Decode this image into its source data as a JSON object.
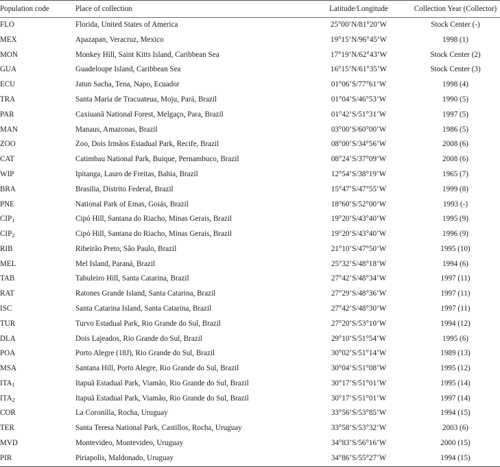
{
  "table": {
    "columns": [
      {
        "key": "code",
        "label": "Population code"
      },
      {
        "key": "place",
        "label": "Place of collection"
      },
      {
        "key": "coord",
        "label": "Latitude/Longitude"
      },
      {
        "key": "year",
        "label": "Collection Year (Collector)"
      }
    ],
    "rows": [
      {
        "code": "FLO",
        "code_sub": "",
        "place": "Florida,  United States of America",
        "coord": "25°00’N/81°20’W",
        "year": "Stock Center (-)"
      },
      {
        "code": "MEX",
        "code_sub": "",
        "place": "Apazapan,  Veracruz,  Mexico",
        "coord": "19°15’N/96°45’W",
        "year": "1998 (1)"
      },
      {
        "code": "MON",
        "code_sub": "",
        "place": "Monkey Hill,  Saint Kitts Island,  Caribbean Sea",
        "coord": "17°19’N/62°43’W",
        "year": "Stock Center (2)"
      },
      {
        "code": "GUA",
        "code_sub": "",
        "place": "Guadeloupe Island,  Caribbean Sea",
        "coord": "16°15’N/61°35’W",
        "year": "Stock Center (3)"
      },
      {
        "code": "ECU",
        "code_sub": "",
        "place": "Jatun Sacha,  Tena,  Napo,  Ecuador",
        "coord": "01°06’S/77°61’W",
        "year": "1998 (4)"
      },
      {
        "code": "TRA",
        "code_sub": "",
        "place": "Santa Maria de Tracuateua,  Moju,  Pará,  Brazil",
        "coord": "01°04’S/46°53’W",
        "year": "1990 (5)"
      },
      {
        "code": "PAR",
        "code_sub": "",
        "place": "Caxiuanã National Forest,  Melgaço,  Para,  Brazil",
        "coord": "01°42’S/51°31’W",
        "year": "1997 (5)"
      },
      {
        "code": "MAN",
        "code_sub": "",
        "place": "Manaus,  Amazonas,  Brazil",
        "coord": "03°00’S/60°00’W",
        "year": "1986 (5)"
      },
      {
        "code": "ZOO",
        "code_sub": "",
        "place": "Zoo,  Dois Irmãos Estadual Park,  Recife,  Brazil",
        "coord": "08°00’S/34°56’W",
        "year": "2008 (6)"
      },
      {
        "code": "CAT",
        "code_sub": "",
        "place": "Catimbau National Park,  Buique,  Pernambuco,  Brazil",
        "coord": "08°24’S/37°09’W",
        "year": "2008  (6)"
      },
      {
        "code": "WIP",
        "code_sub": "",
        "place": "Ipitanga,  Lauro de Freitas,  Bahia,  Brazil",
        "coord": "12°54’S/38°19’W",
        "year": "1965 (7)"
      },
      {
        "code": "BRA",
        "code_sub": "",
        "place": "Brasilia,  Distrito Federal,  Brazil",
        "coord": "15°47’S/47°55’W",
        "year": "1999 (8)"
      },
      {
        "code": "PNE",
        "code_sub": "",
        "place": "National Park of Emas,  Goiás,  Brazil",
        "coord": "18°60’S/52°00’W",
        "year": "1993 (-)"
      },
      {
        "code": "CIP",
        "code_sub": "1",
        "place": "Cipó Hill,  Santana do Riacho,  Minas Gerais,  Brazil",
        "coord": "19°20’S/43°40’W",
        "year": "1995 (9)"
      },
      {
        "code": "CIP",
        "code_sub": "2",
        "place": "Cipó Hill,  Santana do Riacho,  Minas Gerais,  Brazil",
        "coord": "19°20’S/43°40’W",
        "year": "1996 (9)"
      },
      {
        "code": "RIB",
        "code_sub": "",
        "place": "Ribeirão Preto,  São Paulo,  Brazil",
        "coord": "21°10’S/47°50’W",
        "year": "1995 (10)"
      },
      {
        "code": "MEL",
        "code_sub": "",
        "place": "Mel Island,  Paraná,  Brazil",
        "coord": "25°32’S/48°18’W",
        "year": "1994 (6)"
      },
      {
        "code": "TAB",
        "code_sub": "",
        "place": "Tabuleiro Hill,  Santa Catarina,  Brazil",
        "coord": "27°42’S/48°34’W",
        "year": "1997 (11)"
      },
      {
        "code": "RAT",
        "code_sub": "",
        "place": "Ratones Grande Island,  Santa Catarina,  Brazil",
        "coord": "27°29’S/48°36’W",
        "year": "1997 (11)"
      },
      {
        "code": "ISC",
        "code_sub": "",
        "place": "Santa Catarina Island,  Santa Catarina,  Brazil",
        "coord": "27°42’S/48°30’W",
        "year": "1997 (11)"
      },
      {
        "code": "TUR",
        "code_sub": "",
        "place": "Turvo Estadual Park,  Rio Grande do Sul,  Brazil",
        "coord": "27°20’S/53°10’W",
        "year": "1994 (12)"
      },
      {
        "code": "DLA",
        "code_sub": "",
        "place": "Dois Lajeados,  Rio Grande do Sul,  Brazil",
        "coord": "29°10’S/51°54’W",
        "year": "1995 (6)"
      },
      {
        "code": "POA",
        "code_sub": "",
        "place": "Porto Alegre (18J),  Rio Grande do Sul,  Brazil",
        "coord": "30°02’S/51°14’W",
        "year": "1989 (13)"
      },
      {
        "code": "MSA",
        "code_sub": "",
        "place": "Santana Hill,  Porto Alegre,  Rio Grande do Sul,  Brazil",
        "coord": "30°04’S/51°08’W",
        "year": "1995 (12)"
      },
      {
        "code": "ITA",
        "code_sub": "1",
        "place": "Itapuã Estadual Park,  Viamão,  Rio Grande do Sul,  Brazil",
        "coord": "30°17’S/51°01’W",
        "year": "1995 (14)"
      },
      {
        "code": "ITA",
        "code_sub": "2",
        "place": "Itapuã Estadual Park,  Viamão,  Rio Grande do Sul,  Brazil",
        "coord": "30°17’S/51°01’W",
        "year": "1997 (14)"
      },
      {
        "code": "COR",
        "code_sub": "",
        "place": "La Coronilla,  Rocha,  Uruguay",
        "coord": "33°56’S/53°85’W",
        "year": "1994 (15)"
      },
      {
        "code": "TER",
        "code_sub": "",
        "place": "Santa Teresa National Park,  Castillos,  Rocha,  Uruguay",
        "coord": "33°58’S/53°32’W",
        "year": "2003 (6)"
      },
      {
        "code": "MVD",
        "code_sub": "",
        "place": "Montevideo,  Montevideo,  Uruguay",
        "coord": "34°83’S/56°16’W",
        "year": "2000 (15)"
      },
      {
        "code": "PIR",
        "code_sub": "",
        "place": "Piriapolis,  Maldonado,  Uruguay",
        "coord": "34°86’S/55°27’W",
        "year": "1994 (15)"
      }
    ]
  }
}
